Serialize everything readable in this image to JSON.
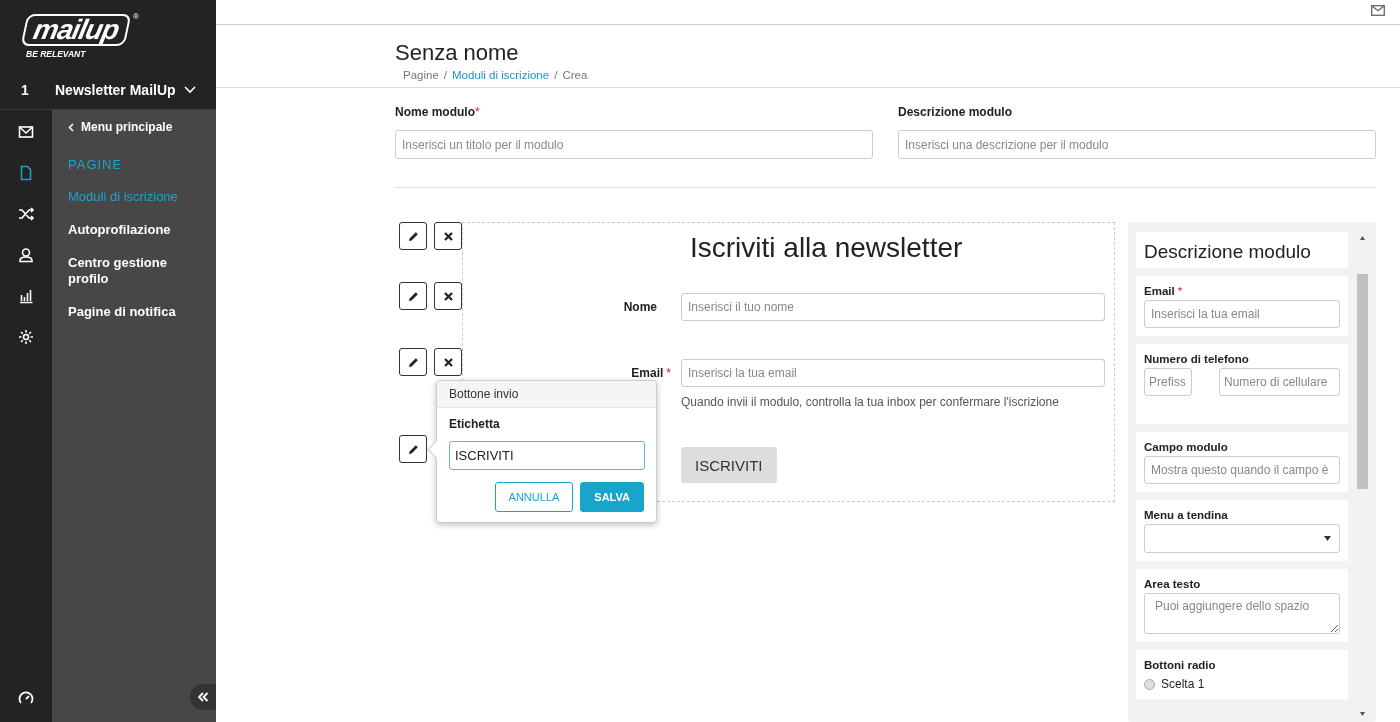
{
  "sidebar": {
    "logo": "mailup",
    "logo_mark": "®",
    "tagline": "BE RELEVANT",
    "account": {
      "number": "1",
      "name": "Newsletter MailUp"
    },
    "rail_icons": [
      {
        "kind": "mail",
        "selected": false
      },
      {
        "kind": "page",
        "selected": true
      },
      {
        "kind": "shuffle",
        "selected": false
      },
      {
        "kind": "user",
        "selected": false
      },
      {
        "kind": "chart",
        "selected": false
      },
      {
        "kind": "gear",
        "selected": false
      }
    ],
    "back": "Menu principale",
    "section": "PAGINE",
    "items": [
      {
        "label": "Moduli di iscrizione",
        "selected": true
      },
      {
        "label": "Autoprofilazione",
        "selected": false
      },
      {
        "label": "Centro gestione profilo",
        "selected": false
      },
      {
        "label": "Pagine di notifica",
        "selected": false
      }
    ]
  },
  "header": {
    "title": "Senza nome",
    "separator": "/",
    "breadcrumb": [
      {
        "label": "Pagine",
        "link": false
      },
      {
        "label": "Moduli di iscrizione",
        "link": true
      },
      {
        "label": "Crea",
        "link": false
      }
    ]
  },
  "fields": [
    {
      "label": "Nome modulo",
      "mark": "*",
      "placeholder": "Inserisci un titolo per il modulo"
    },
    {
      "label": "Descrizione modulo",
      "placeholder": "Inserisci una descrizione per il modulo"
    }
  ],
  "block_tools": [
    {
      "kind": "edit-delete"
    },
    {
      "kind": "edit-delete"
    },
    {
      "kind": "edit-delete"
    },
    {
      "kind": "edit"
    }
  ],
  "form": {
    "title": "Iscriviti alla newsletter",
    "fields": [
      {
        "label": "Nome",
        "placeholder": "Inserisci il tuo nome"
      },
      {
        "label": "Email",
        "mark": "*",
        "placeholder": "Inserisci la tua email",
        "help": "Quando invii il modulo, controlla la tua inbox per confermare l'iscrizione"
      }
    ],
    "submit": "ISCRIVITI"
  },
  "popup": {
    "title": "Bottone invio",
    "label": "Etichetta",
    "value": "ISCRIVITI",
    "cancel": "ANNULLA",
    "save": "SALVA"
  },
  "palette": {
    "title": "Descrizione modulo",
    "items": [
      {
        "kind": "input",
        "label": "Email",
        "mark": "*",
        "placeholder": "Inserisci la tua email"
      },
      {
        "kind": "phone",
        "label": "Numero di telefono",
        "placeholders": [
          "Prefiss",
          "Numero di cellulare"
        ]
      },
      {
        "kind": "input",
        "label": "Campo modulo",
        "placeholder": "Mostra questo quando il campo è"
      },
      {
        "kind": "select",
        "label": "Menu a tendina"
      },
      {
        "kind": "textarea",
        "label": "Area testo",
        "placeholder": "Puoi aggiungere dello spazio"
      },
      {
        "kind": "radio",
        "label": "Bottoni radio",
        "options": [
          {
            "label": "Scelta 1",
            "checked": false
          }
        ]
      }
    ]
  }
}
